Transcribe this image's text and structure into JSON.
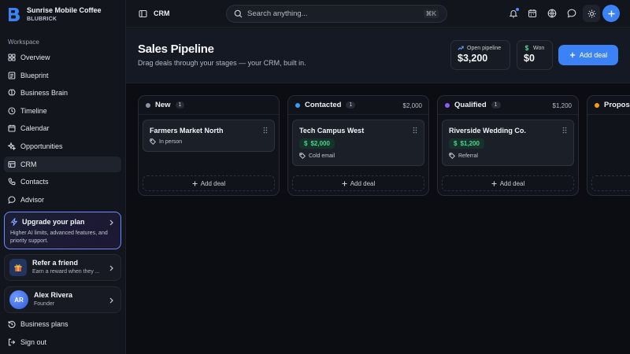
{
  "brand": {
    "name": "Sunrise Mobile Coffee",
    "subtitle": "BLUBRICK"
  },
  "sidebar": {
    "section_label": "Workspace",
    "items": [
      {
        "label": "Overview",
        "icon": "grid-icon"
      },
      {
        "label": "Blueprint",
        "icon": "blueprint-icon"
      },
      {
        "label": "Business Brain",
        "icon": "brain-icon"
      },
      {
        "label": "Timeline",
        "icon": "timeline-icon"
      },
      {
        "label": "Calendar",
        "icon": "calendar-icon"
      },
      {
        "label": "Opportunities",
        "icon": "sparkle-icon"
      },
      {
        "label": "CRM",
        "icon": "crm-icon",
        "active": true
      },
      {
        "label": "Contacts",
        "icon": "phone-icon"
      },
      {
        "label": "Advisor",
        "icon": "chat-icon"
      }
    ],
    "upgrade": {
      "title": "Upgrade your plan",
      "description": "Higher AI limits, advanced features, and priority support."
    },
    "referral": {
      "title": "Refer a friend",
      "subtitle": "Earn a reward when they ..."
    },
    "user": {
      "initials": "AR",
      "name": "Alex Rivera",
      "role": "Founder"
    },
    "bottom": {
      "business_plans": "Business plans",
      "sign_out": "Sign out"
    }
  },
  "topbar": {
    "title": "CRM",
    "search_placeholder": "Search anything...",
    "shortcut": "⌘K"
  },
  "header": {
    "title": "Sales Pipeline",
    "subtitle": "Drag deals through your stages — your CRM, built in.",
    "stats": [
      {
        "label": "Open pipeline",
        "value": "$3,200"
      },
      {
        "label": "Won",
        "value": "$0"
      }
    ],
    "add_deal_label": "Add deal"
  },
  "columns": [
    {
      "name": "New",
      "count": "1",
      "total": "",
      "color": "#8b93a7",
      "deal": {
        "name": "Farmers Market North",
        "amount": "",
        "tag": "In person"
      }
    },
    {
      "name": "Contacted",
      "count": "1",
      "total": "$2,000",
      "color": "#3b9cf6",
      "deal": {
        "name": "Tech Campus West",
        "amount": "$2,000",
        "tag": "Cold email"
      }
    },
    {
      "name": "Qualified",
      "count": "1",
      "total": "$1,200",
      "color": "#8b5cf6",
      "deal": {
        "name": "Riverside Wedding Co.",
        "amount": "$1,200",
        "tag": "Referral"
      }
    },
    {
      "name": "Proposal",
      "count": "",
      "total": "",
      "color": "#f59e0b",
      "deal": null
    }
  ],
  "column_add_label": "Add deal",
  "colors": {
    "accent": "#3b82f6",
    "success": "#4fd18b",
    "background": "#0b0d12"
  }
}
